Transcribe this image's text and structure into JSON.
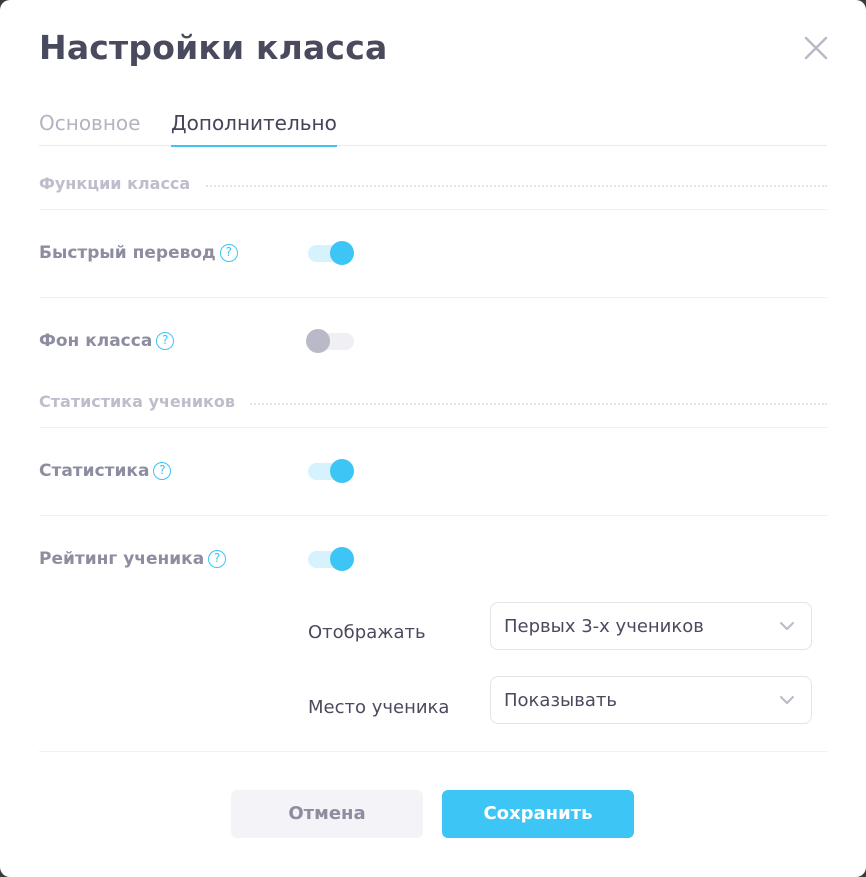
{
  "dialog": {
    "title": "Настройки класса"
  },
  "tabs": [
    {
      "label": "Основное",
      "active": false
    },
    {
      "label": "Дополнительно",
      "active": true
    }
  ],
  "sections": {
    "class_functions": {
      "label": "Функции класса",
      "items": [
        {
          "label": "Быстрый перевод",
          "enabled": true,
          "help": "?"
        },
        {
          "label": "Фон класса",
          "enabled": false,
          "help": "?"
        }
      ]
    },
    "student_stats": {
      "label": "Статистика учеников",
      "items": [
        {
          "label": "Статистика",
          "enabled": true,
          "help": "?"
        },
        {
          "label": "Рейтинг ученика",
          "enabled": true,
          "help": "?"
        }
      ]
    }
  },
  "rating_options": {
    "display": {
      "label": "Отображать",
      "value": "Первых 3-х учеников"
    },
    "place": {
      "label": "Место ученика",
      "value": "Показывать"
    }
  },
  "buttons": {
    "cancel": "Отмена",
    "save": "Сохранить"
  },
  "colors": {
    "accent": "#3cc5f5",
    "text": "#4a4a5e",
    "muted": "#8d8da0"
  },
  "icons": {
    "close": "close-icon",
    "help": "help-icon",
    "chevron": "chevron-down-icon"
  }
}
